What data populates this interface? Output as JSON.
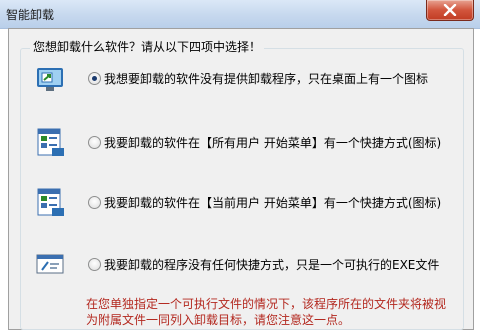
{
  "window": {
    "title": "智能卸载"
  },
  "question": "您想卸载什么软件？请从以下四项中选择！",
  "options": [
    {
      "label": "我想要卸载的软件没有提供卸载程序，只在桌面上有一个图标",
      "icon": "desktop-shortcut-icon",
      "selected": true
    },
    {
      "label": "我要卸载的软件在【所有用户 开始菜单】有一个快捷方式(图标)",
      "icon": "all-users-start-menu-icon",
      "selected": false
    },
    {
      "label": "我要卸载的软件在【当前用户 开始菜单】有一个快捷方式(图标)",
      "icon": "current-user-start-menu-icon",
      "selected": false
    },
    {
      "label": "我要卸载的程序没有任何快捷方式，只是一个可执行的EXE文件",
      "icon": "exe-file-icon",
      "selected": false
    }
  ],
  "note": {
    "line1": "在您单独指定一个可执行文件的情况下，该程序所在的文件夹将被视",
    "line2": "为附属文件一同列入卸载目标，请您注意这一点。"
  },
  "colors": {
    "note": "#b3281f",
    "titlebar": "#c6d8ee",
    "close": "#c13c23"
  }
}
